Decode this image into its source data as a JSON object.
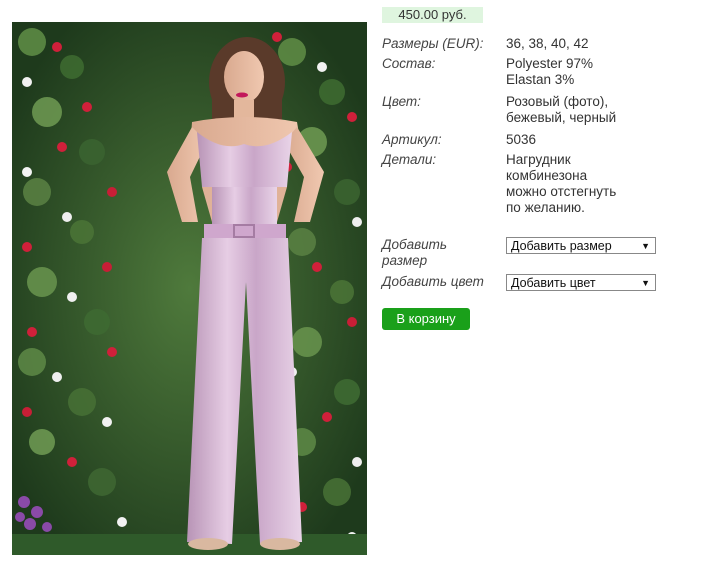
{
  "product": {
    "price": "450.00 руб.",
    "image_alt": "Розовый комбинезон"
  },
  "specs": [
    {
      "label": "Размеры (EUR):",
      "lines": [
        "36, 38, 40, 42"
      ]
    },
    {
      "label": "Состав:",
      "lines": [
        "Polyester 97%",
        "Elastan 3%"
      ]
    },
    {
      "label": "Цвет:",
      "lines": [
        "Розовый (фото),",
        "бежевый, черный"
      ]
    },
    {
      "label": "Артикул:",
      "lines": [
        "5036"
      ]
    },
    {
      "label": "Детали:",
      "lines": [
        "Нагрудник",
        "комбинезона",
        "можно отстегнуть",
        "по желанию."
      ]
    }
  ],
  "options": {
    "size_label_1": "Добавить",
    "size_label_2": "размер",
    "size_select": "Добавить размер",
    "color_label": "Добавить цвет",
    "color_select": "Добавить цвет"
  },
  "cart_button": "В корзину",
  "colors": {
    "price_bg": "#dff5df",
    "cart_button": "#1aa01a",
    "garment": "#d9b9d8"
  },
  "icons": [
    "chevron-down-icon"
  ]
}
